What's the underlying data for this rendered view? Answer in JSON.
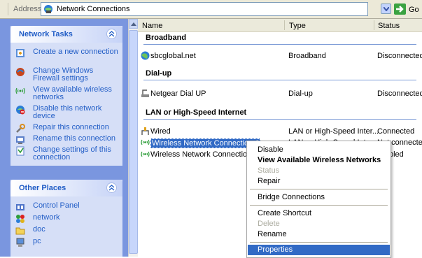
{
  "address_bar": {
    "label": "Address",
    "path": "Network Connections",
    "go_label": "Go"
  },
  "network_tasks": {
    "title": "Network Tasks",
    "items": [
      {
        "label": "Create a new connection",
        "icon": "new-connection-icon"
      },
      {
        "label": "Change Windows Firewall settings",
        "icon": "firewall-icon"
      },
      {
        "label": "View available wireless networks",
        "icon": "wireless-icon"
      },
      {
        "label": "Disable this network device",
        "icon": "disable-device-icon"
      },
      {
        "label": "Repair this connection",
        "icon": "repair-icon"
      },
      {
        "label": "Rename this connection",
        "icon": "rename-icon"
      },
      {
        "label": "Change settings of this connection",
        "icon": "settings-icon"
      }
    ]
  },
  "other_places": {
    "title": "Other Places",
    "items": [
      {
        "label": "Control Panel",
        "icon": "control-panel-icon"
      },
      {
        "label": "network",
        "icon": "network-icon"
      },
      {
        "label": "doc",
        "icon": "folder-icon"
      },
      {
        "label": "pc",
        "icon": "computer-icon"
      }
    ]
  },
  "list": {
    "columns": {
      "name": "Name",
      "type": "Type",
      "status": "Status"
    },
    "groups": [
      {
        "title": "Broadband",
        "rows": [
          {
            "name": "sbcglobal.net",
            "type": "Broadband",
            "status": "Disconnected",
            "icon": "globe-icon"
          }
        ]
      },
      {
        "title": "Dial-up",
        "rows": [
          {
            "name": "Netgear Dial UP",
            "type": "Dial-up",
            "status": "Disconnected",
            "icon": "dialup-icon"
          }
        ]
      },
      {
        "title": "LAN or High-Speed Internet",
        "rows": [
          {
            "name": "Wired",
            "type": "LAN or High-Speed Inter...",
            "status": "Connected",
            "icon": "lan-icon"
          },
          {
            "name": "Wireless Network Connection 6",
            "type": "LAN or High-Speed Inter...",
            "status": "Not connected",
            "icon": "wireless-icon"
          },
          {
            "name": "Wireless Network Connection",
            "type": "",
            "status": "bled",
            "icon": "wireless-icon"
          }
        ]
      }
    ]
  },
  "context_menu": {
    "items": [
      {
        "label": "Disable",
        "style": "normal"
      },
      {
        "label": "View Available Wireless Networks",
        "style": "bold"
      },
      {
        "label": "Status",
        "style": "disabled"
      },
      {
        "label": "Repair",
        "style": "normal"
      },
      {
        "label": "Bridge Connections",
        "style": "normal"
      },
      {
        "label": "Create Shortcut",
        "style": "normal"
      },
      {
        "label": "Delete",
        "style": "disabled"
      },
      {
        "label": "Rename",
        "style": "normal"
      },
      {
        "label": "Properties",
        "style": "highlighted"
      }
    ]
  },
  "colors": {
    "sidebar": "#7a96df",
    "panel": "#d6dff7",
    "link": "#215dc6",
    "selection": "#316ac5"
  }
}
